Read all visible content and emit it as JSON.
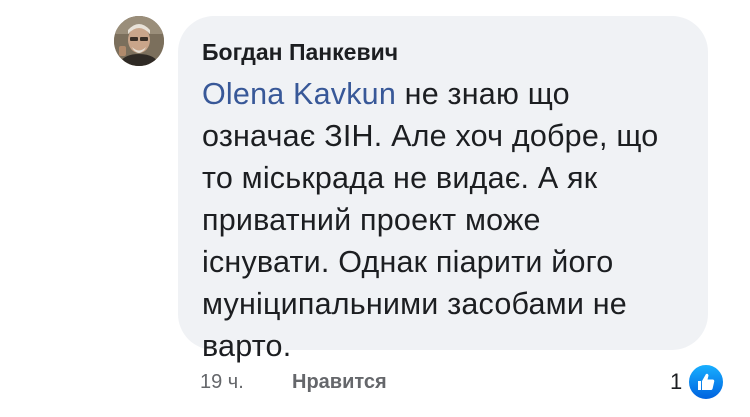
{
  "comment": {
    "author": "Богдан Панкевич",
    "mention": "Olena Kavkun",
    "text_lines": [
      " не знаю що",
      "означає ЗІН. Але хоч добре, що",
      "то міськрада не видає. А як",
      "приватний проект може",
      "існувати. Однак піарити його",
      "муніципальними засобами не",
      "варто."
    ],
    "timestamp": "19 ч.",
    "like_label": "Нравится",
    "reaction_count": "1"
  },
  "icons": {
    "avatar": "user-avatar-photo",
    "reaction": "thumbs-up-icon"
  },
  "colors": {
    "bubble_bg": "#f0f2f5",
    "mention": "#385898",
    "meta_text": "#65676b",
    "like_badge": "#1877f2"
  }
}
